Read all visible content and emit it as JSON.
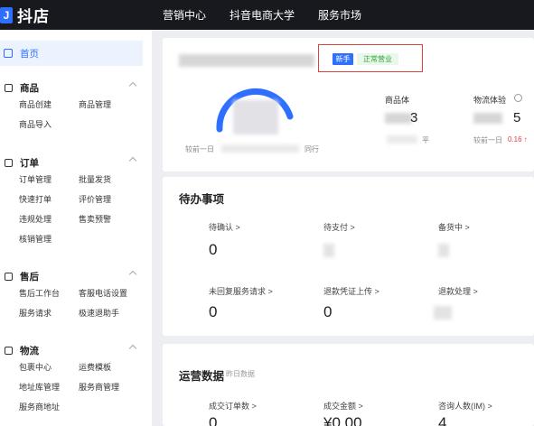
{
  "header": {
    "logo_mark": "J",
    "logo_text": "抖店",
    "nav": [
      "营销中心",
      "抖音电商大学",
      "服务市场"
    ]
  },
  "sidebar": {
    "home": "首页",
    "sections": [
      {
        "title": "商品",
        "items": [
          "商品创建",
          "商品管理",
          "商品导入"
        ]
      },
      {
        "title": "订单",
        "items": [
          "订单管理",
          "批量发货",
          "快速打单",
          "评价管理",
          "违规处理",
          "售卖预警",
          "核销管理"
        ]
      },
      {
        "title": "售后",
        "items": [
          "售后工作台",
          "客服电话设置",
          "服务请求",
          "极速退助手"
        ]
      },
      {
        "title": "物流",
        "items": [
          "包裹中心",
          "运费模板",
          "地址库管理",
          "服务商管理",
          "服务商地址"
        ]
      }
    ]
  },
  "store_card": {
    "tag_new": "新手",
    "tag_status": "正常营业",
    "compare_left": "较前一日",
    "peer_label": "同行",
    "metric_product": "商品体",
    "metric_product_sub": "平",
    "metric_logistics": "物流体验",
    "logistics_compare": "较前一日",
    "logistics_delta": "0.16 ↑",
    "logistics_digit": "5",
    "product_digit": "3"
  },
  "todo": {
    "title": "待办事项",
    "items": [
      {
        "label": "待确认 >",
        "value": "0"
      },
      {
        "label": "待支付 >",
        "value": ""
      },
      {
        "label": "备货中 >",
        "value": ""
      },
      {
        "label": "未回复服务请求 >",
        "value": "0"
      },
      {
        "label": "退款凭证上传 >",
        "value": "0"
      },
      {
        "label": "退款处理 >",
        "value": ""
      }
    ]
  },
  "ops": {
    "title": "运营数据",
    "subtitle": "昨日数据",
    "items": [
      {
        "label": "成交订单数 >",
        "value": "0"
      },
      {
        "label": "成交金额 >",
        "value": "¥0.00"
      },
      {
        "label": "咨询人数(IM) >",
        "value": "4"
      }
    ]
  },
  "colors": {
    "accent": "#2f6fff",
    "topbar": "#17191f",
    "alert": "#e0403a",
    "success": "#2fa63a"
  }
}
